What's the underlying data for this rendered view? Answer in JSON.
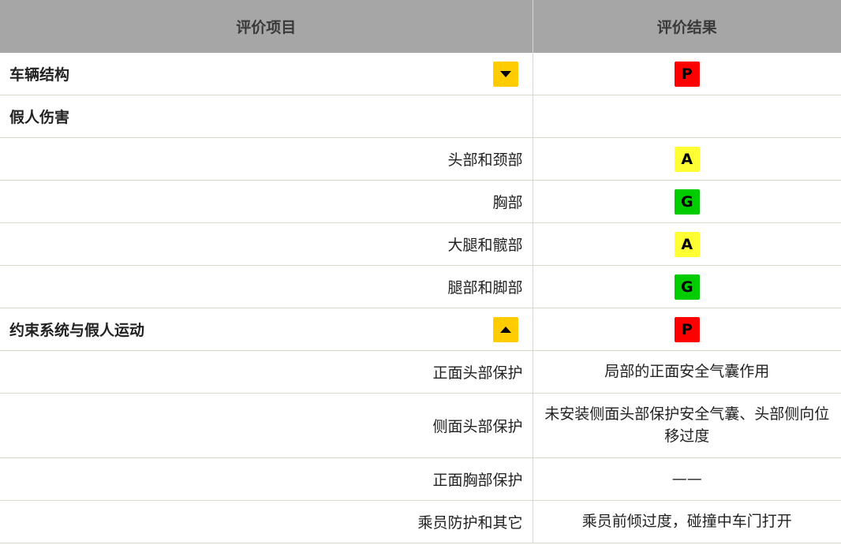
{
  "table": {
    "headers": [
      "评价项目",
      "评价结果"
    ],
    "rows": [
      {
        "label": "车辆结构",
        "kind": "group",
        "toggle": "collapse-down",
        "badge": "P"
      },
      {
        "label": "假人伤害",
        "kind": "group"
      },
      {
        "label": "头部和颈部",
        "kind": "sub",
        "badge": "A"
      },
      {
        "label": "胸部",
        "kind": "sub",
        "badge": "G"
      },
      {
        "label": "大腿和髋部",
        "kind": "sub",
        "badge": "A"
      },
      {
        "label": "腿部和脚部",
        "kind": "sub",
        "badge": "G"
      },
      {
        "label": "约束系统与假人运动",
        "kind": "group",
        "toggle": "expand-up",
        "badge": "P"
      },
      {
        "label": "正面头部保护",
        "kind": "sub",
        "result": "局部的正面安全气囊作用"
      },
      {
        "label": "侧面头部保护",
        "kind": "sub",
        "result": "未安装侧面头部保护安全气囊、头部侧向位移过度"
      },
      {
        "label": "正面胸部保护",
        "kind": "sub",
        "result": "——"
      },
      {
        "label": "乘员防护和其它",
        "kind": "sub",
        "result": "乘员前倾过度，碰撞中车门打开"
      }
    ]
  },
  "badge_colors": {
    "P": "#ff0000",
    "A": "#ffff33",
    "G": "#00cc00"
  },
  "toggle_color": "#ffcc00",
  "header_bg": "#a6a6a6"
}
